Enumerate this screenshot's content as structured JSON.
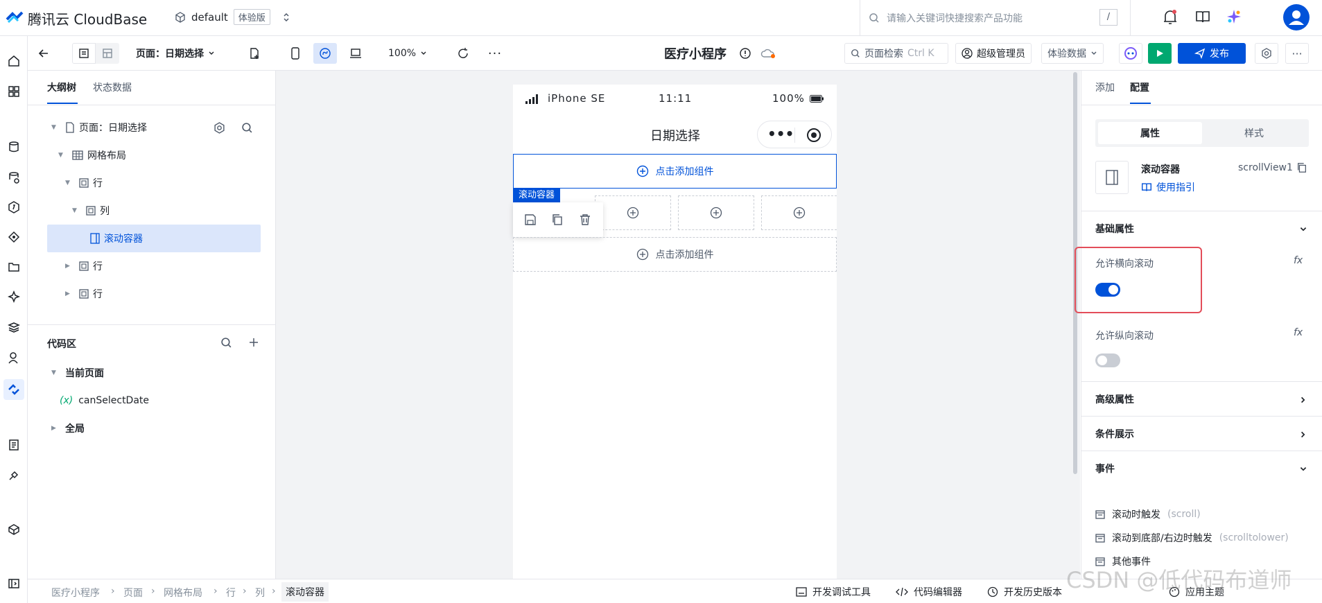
{
  "app": {
    "brand": "腾讯云 CloudBase",
    "env_name": "default",
    "env_badge": "体验版",
    "search_placeholder": "请输入关键词快捷搜索产品功能",
    "search_shortcut": "/"
  },
  "toolbar": {
    "page_selector": "页面：日期选择",
    "zoom": "100%",
    "app_title": "医疗小程序",
    "page_search": "页面检索",
    "page_search_shortcut": "Ctrl K",
    "role": "超级管理员",
    "data_mode": "体验数据",
    "publish": "发布"
  },
  "left_panel": {
    "tabs": [
      "大纲树",
      "状态数据"
    ],
    "tree": [
      {
        "label": "页面：日期选择"
      },
      {
        "label": "网格布局"
      },
      {
        "label": "行"
      },
      {
        "label": "列"
      },
      {
        "label": "滚动容器"
      },
      {
        "label": "行"
      },
      {
        "label": "行"
      }
    ],
    "code_area": {
      "title": "代码区",
      "current_page": "当前页面",
      "var_symbol": "(x)",
      "var_name": "canSelectDate",
      "global": "全局"
    }
  },
  "phone": {
    "carrier": "iPhone SE",
    "time": "11:11",
    "battery": "100%",
    "page_title": "日期选择",
    "add_component": "点击添加组件",
    "selected_tag": "滚动容器"
  },
  "right_panel": {
    "tabs": [
      "添加",
      "配置"
    ],
    "subtabs": [
      "属性",
      "样式"
    ],
    "component_name": "滚动容器",
    "component_id": "scrollView1",
    "usage_guide": "使用指引",
    "basic_props": "基础属性",
    "prop_horizontal": "允许横向滚动",
    "prop_horizontal_on": true,
    "prop_vertical": "允许纵向滚动",
    "prop_vertical_on": false,
    "fx": "fx",
    "advanced": "高级属性",
    "condition": "条件展示",
    "events_title": "事件",
    "events": [
      {
        "label": "滚动时触发",
        "code": "(scroll)"
      },
      {
        "label": "滚动到底部/右边时触发",
        "code": "(scrolltolower)"
      },
      {
        "label": "其他事件",
        "code": ""
      }
    ]
  },
  "bottom_bar": {
    "breadcrumbs": [
      "医疗小程序",
      "页面",
      "网格布局",
      "行",
      "列",
      "滚动容器"
    ],
    "tools": [
      "开发调试工具",
      "代码编辑器",
      "开发历史版本",
      "应用主题"
    ]
  },
  "watermark": "CSDN @低代码布道师",
  "colors": {
    "primary": "#0052d9",
    "publish": "#0052d9",
    "run": "#00a870",
    "highlight": "#e34d59",
    "selected_row": "#dbe6fb"
  }
}
